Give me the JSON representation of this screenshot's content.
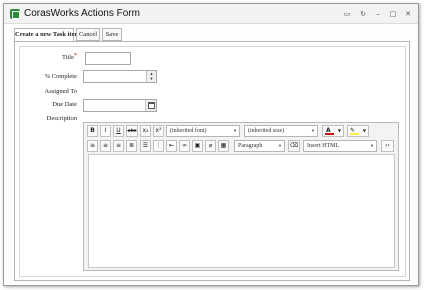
{
  "window": {
    "title": "CorasWorks Actions Form",
    "controls": [
      "settings-icon",
      "refresh-icon",
      "minimize-icon",
      "maximize-icon",
      "close-icon"
    ]
  },
  "tabs": [
    {
      "label": "Create a new Task item",
      "active": true
    },
    {
      "label": "Cancel",
      "active": false
    },
    {
      "label": "Save",
      "active": false
    }
  ],
  "form": {
    "title_label": "Title",
    "title_required": "*",
    "title_value": "",
    "percent_label": "% Complete",
    "percent_value": "",
    "assigned_label": "Assigned To",
    "due_label": "Due Date",
    "due_value": "",
    "description_label": "Description"
  },
  "editor": {
    "bold": "B",
    "italic": "I",
    "underline": "U",
    "strike": "abc",
    "subscript": "x₂",
    "superscript": "x²",
    "font_family": "(inherited font)",
    "font_size": "(inherited size)",
    "font_color": "A",
    "paragraph": "Paragraph",
    "insert_html": "Insert HTML",
    "font_color_hex": "#d01010",
    "highlight_hex": "#ffeb3b"
  }
}
